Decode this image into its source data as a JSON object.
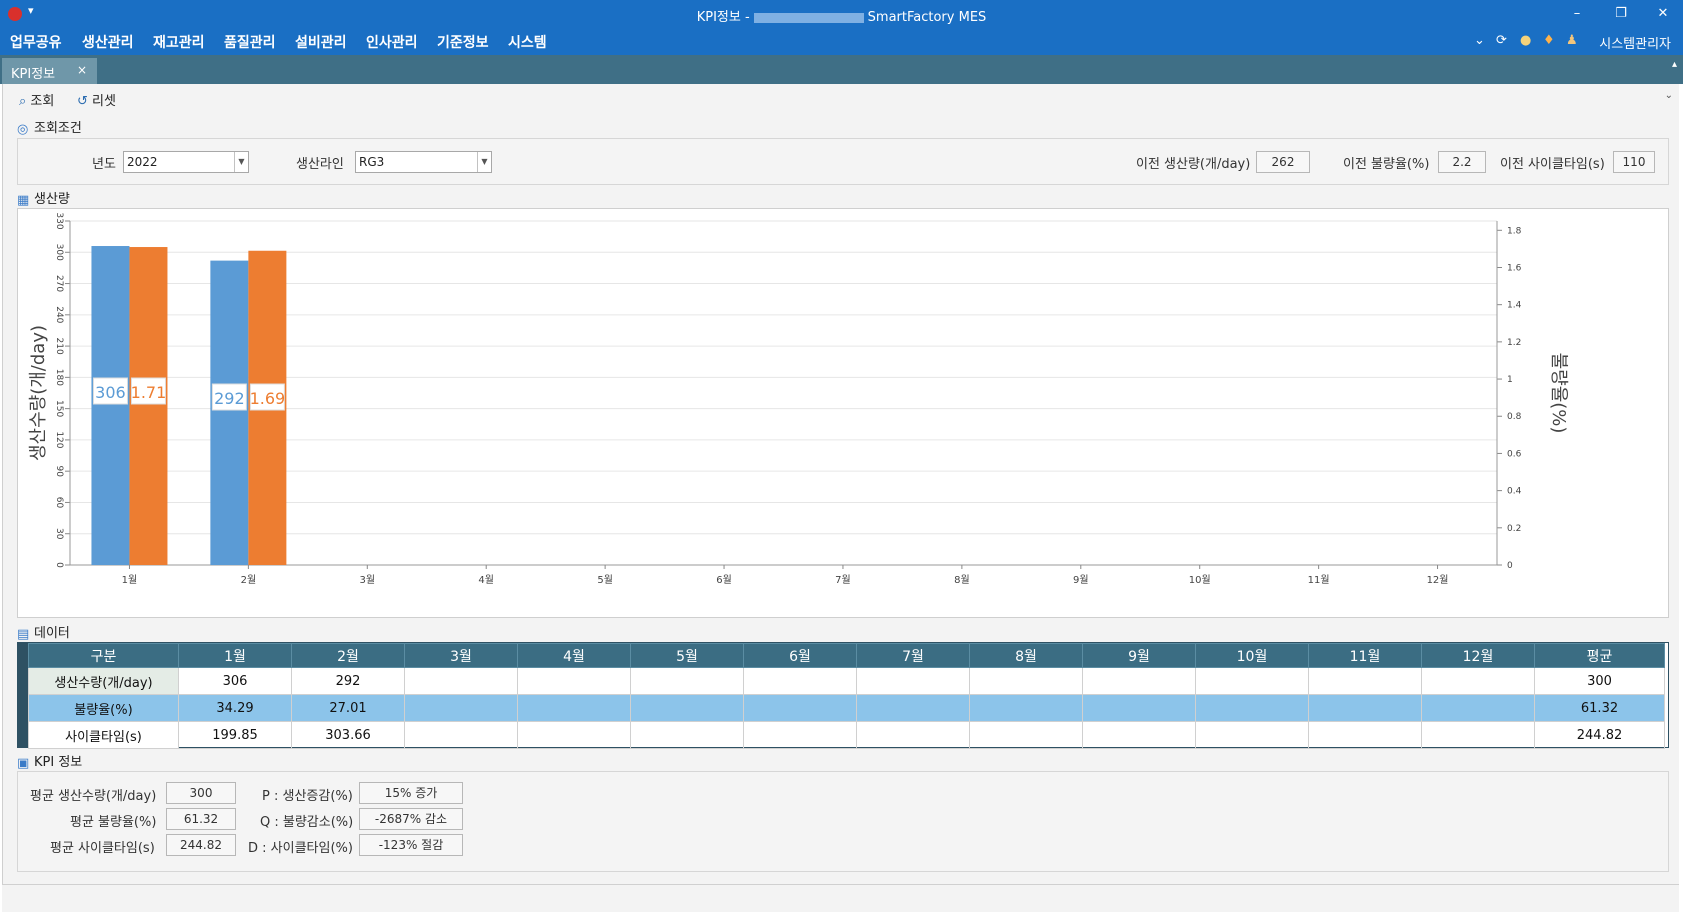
{
  "window": {
    "title_prefix": "KPI정보 -",
    "title_suffix": "SmartFactory MES",
    "minimize": "–",
    "restore": "❐",
    "close": "✕"
  },
  "menu": {
    "items": [
      "업무공유",
      "생산관리",
      "재고관리",
      "품질관리",
      "설비관리",
      "인사관리",
      "기준정보",
      "시스템"
    ],
    "user": "시스템관리자",
    "dropdown_icon": "chevron-down-icon",
    "refresh_icon": "refresh-icon"
  },
  "tab": {
    "label": "KPI정보",
    "close": "×"
  },
  "toolbar": {
    "search_label": "조회",
    "reset_label": "리셋"
  },
  "conditions": {
    "title": "조회조건",
    "year_label": "년도",
    "year_value": "2022",
    "line_label": "생산라인",
    "line_value": "RG3",
    "prev_production_label": "이전 생산량(개/day)",
    "prev_production_value": "262",
    "prev_defect_label": "이전 불량율(%)",
    "prev_defect_value": "2.2",
    "prev_cycle_label": "이전 사이클타임(s)",
    "prev_cycle_value": "110"
  },
  "chart_section_title": "생산량",
  "chart_data": {
    "type": "bar",
    "categories": [
      "1월",
      "2월",
      "3월",
      "4월",
      "5월",
      "6월",
      "7월",
      "8월",
      "9월",
      "10월",
      "11월",
      "12월"
    ],
    "series": [
      {
        "values": [
          306,
          292,
          null,
          null,
          null,
          null,
          null,
          null,
          null,
          null,
          null,
          null
        ],
        "axis": "left",
        "color": "#5b9bd5"
      },
      {
        "values": [
          1.71,
          1.69,
          null,
          null,
          null,
          null,
          null,
          null,
          null,
          null,
          null,
          null
        ],
        "axis": "right",
        "color": "#ed7d31"
      }
    ],
    "data_labels": [
      "306",
      "1.71",
      "292",
      "1.69"
    ],
    "ylabel": "생산수량(개/day)",
    "y2label": "불량율(%)",
    "ylim": [
      0,
      330
    ],
    "y2lim": [
      0,
      1.85
    ],
    "yticks": [
      0,
      30,
      60,
      90,
      120,
      150,
      180,
      210,
      240,
      270,
      300,
      330
    ],
    "y2ticks": [
      "0",
      "0.2",
      "0.4",
      "0.6",
      "0.8",
      "1",
      "1.2",
      "1.4",
      "1.6",
      "1.8"
    ],
    "grid": true
  },
  "data_section": {
    "title": "데이터",
    "headers": [
      "구분",
      "1월",
      "2월",
      "3월",
      "4월",
      "5월",
      "6월",
      "7월",
      "8월",
      "9월",
      "10월",
      "11월",
      "12월",
      "평균"
    ],
    "rows": [
      [
        "생산수량(개/day)",
        "306",
        "292",
        "",
        "",
        "",
        "",
        "",
        "",
        "",
        "",
        "",
        "",
        "300"
      ],
      [
        "불량율(%)",
        "34.29",
        "27.01",
        "",
        "",
        "",
        "",
        "",
        "",
        "",
        "",
        "",
        "",
        "61.32"
      ],
      [
        "사이클타임(s)",
        "199.85",
        "303.66",
        "",
        "",
        "",
        "",
        "",
        "",
        "",
        "",
        "",
        "",
        "244.82"
      ]
    ],
    "selected_row": 1
  },
  "kpi": {
    "title": "KPI 정보",
    "avg_production_label": "평균 생산수량(개/day)",
    "avg_production_value": "300",
    "avg_defect_label": "평균 불량율(%)",
    "avg_defect_value": "61.32",
    "avg_cycle_label": "평균 사이클타임(s)",
    "avg_cycle_value": "244.82",
    "p_label": "P : 생산증감(%)",
    "p_value": "15% 증가",
    "q_label": "Q : 불량감소(%)",
    "q_value": "-2687% 감소",
    "d_label": "D : 사이클타임(%)",
    "d_value": "-123% 절감"
  },
  "colors": {
    "titlebar": "#1a6fc4",
    "tabstrip": "#3f6f86",
    "grid_header": "#3b6d83",
    "selected_row": "#8cc4ea",
    "bar_blue": "#5b9bd5",
    "bar_orange": "#ed7d31"
  }
}
